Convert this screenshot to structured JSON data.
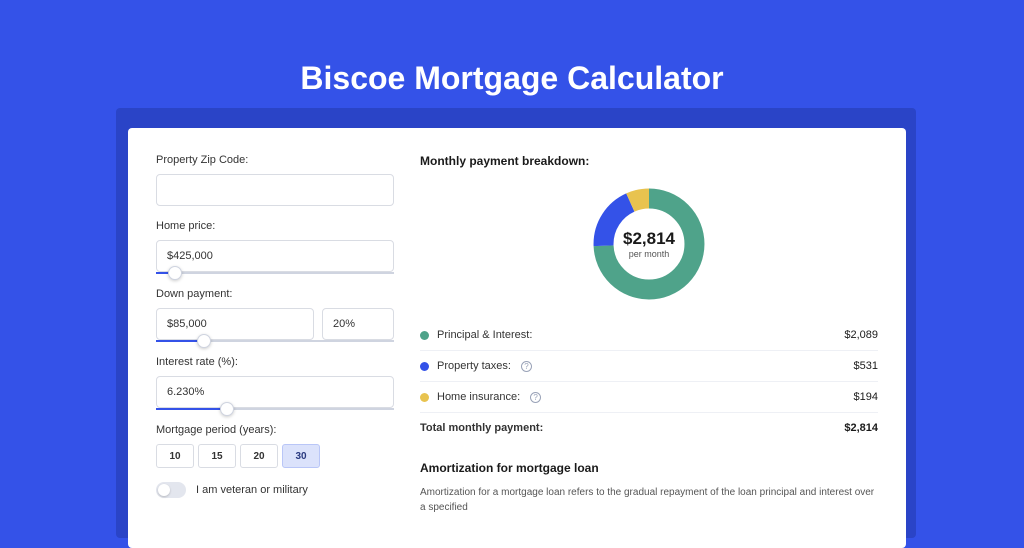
{
  "page": {
    "title": "Biscoe Mortgage Calculator"
  },
  "form": {
    "zip": {
      "label": "Property Zip Code:",
      "value": ""
    },
    "home_price": {
      "label": "Home price:",
      "value": "$425,000",
      "slider_pct": 8
    },
    "down_payment": {
      "label": "Down payment:",
      "amount": "$85,000",
      "percent": "20%",
      "slider_pct": 20
    },
    "interest_rate": {
      "label": "Interest rate (%):",
      "value": "6.230%",
      "slider_pct": 30
    },
    "period": {
      "label": "Mortgage period (years):",
      "options": [
        "10",
        "15",
        "20",
        "30"
      ],
      "selected": "30"
    },
    "veteran": {
      "label": "I am veteran or military",
      "on": false
    }
  },
  "breakdown": {
    "title": "Monthly payment breakdown:",
    "center_amount": "$2,814",
    "center_sub": "per month",
    "items": [
      {
        "label": "Principal & Interest:",
        "value": "$2,089",
        "color": "#4fa38a",
        "has_help": false
      },
      {
        "label": "Property taxes:",
        "value": "$531",
        "color": "#3452e8",
        "has_help": true
      },
      {
        "label": "Home insurance:",
        "value": "$194",
        "color": "#e8c34f",
        "has_help": true
      }
    ],
    "total": {
      "label": "Total monthly payment:",
      "value": "$2,814"
    }
  },
  "amortization": {
    "title": "Amortization for mortgage loan",
    "text": "Amortization for a mortgage loan refers to the gradual repayment of the loan principal and interest over a specified"
  },
  "chart_data": {
    "type": "pie",
    "title": "Monthly payment breakdown",
    "series": [
      {
        "name": "Principal & Interest",
        "value": 2089,
        "color": "#4fa38a"
      },
      {
        "name": "Property taxes",
        "value": 531,
        "color": "#3452e8"
      },
      {
        "name": "Home insurance",
        "value": 194,
        "color": "#e8c34f"
      }
    ],
    "total": 2814,
    "center_label": "$2,814 per month"
  }
}
